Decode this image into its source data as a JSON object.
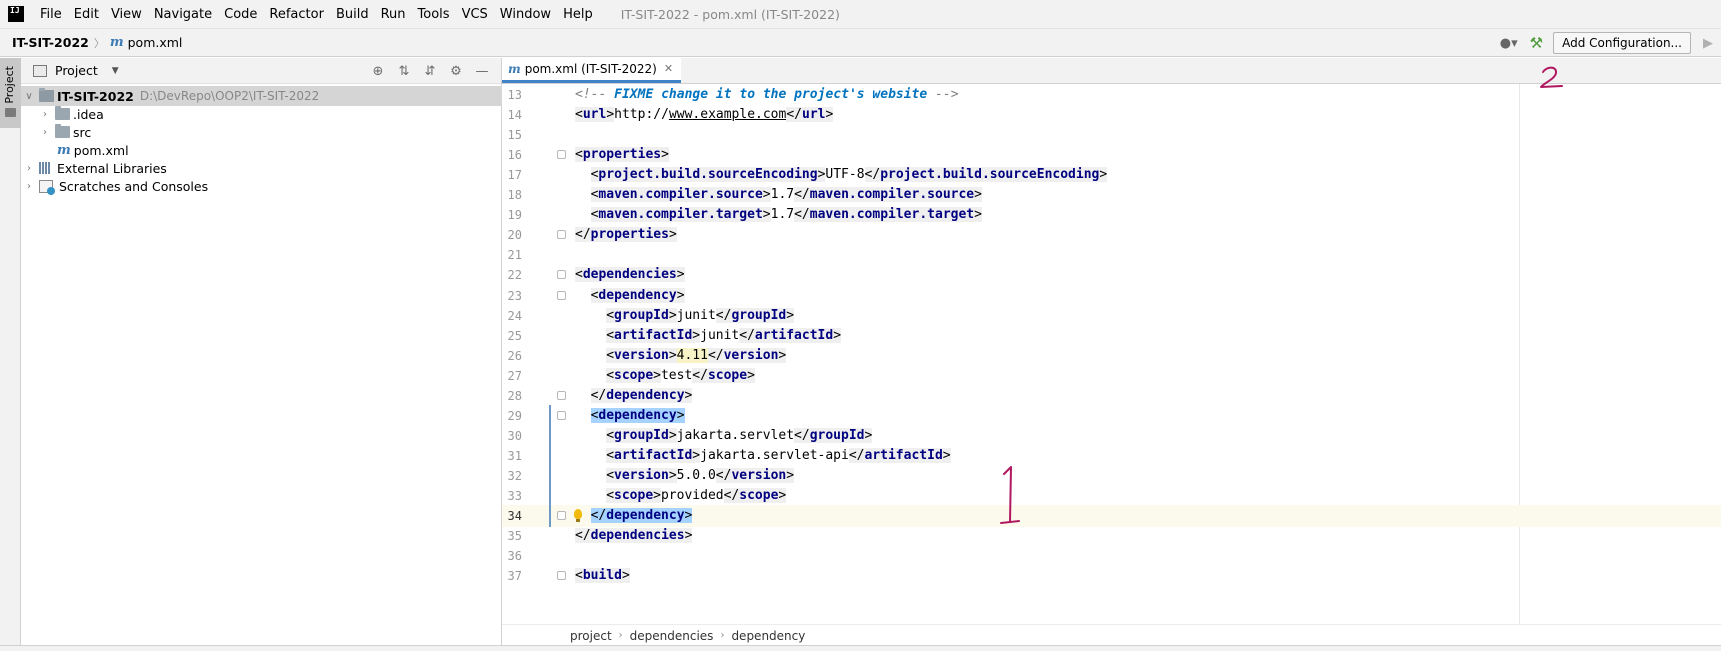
{
  "menu": {
    "logo": "IJ",
    "items": [
      "File",
      "Edit",
      "View",
      "Navigate",
      "Code",
      "Refactor",
      "Build",
      "Run",
      "Tools",
      "VCS",
      "Window",
      "Help"
    ],
    "title": "IT-SIT-2022 - pom.xml (IT-SIT-2022)"
  },
  "navbar": {
    "project": "IT-SIT-2022",
    "file": "pom.xml",
    "add_config_label": "Add Configuration..."
  },
  "toolstrip": {
    "project_label": "Project"
  },
  "project_panel": {
    "title": "Project",
    "tree": [
      {
        "label": "IT-SIT-2022",
        "path": "D:\\DevRepo\\OOP2\\IT-SIT-2022"
      },
      {
        "label": ".idea"
      },
      {
        "label": "src"
      },
      {
        "label": "pom.xml"
      },
      {
        "label": "External Libraries"
      },
      {
        "label": "Scratches and Consoles"
      }
    ]
  },
  "editor": {
    "tab_label": "pom.xml (IT-SIT-2022)",
    "lines": [
      {
        "n": "13",
        "comment_open": "<!-- ",
        "todo": "FIXME change it to the project's website",
        "comment_close": " -->"
      },
      {
        "n": "14",
        "open": "url",
        "text": "http://",
        "ul": "www.example.com",
        "close": "url"
      },
      {
        "n": "15"
      },
      {
        "n": "16",
        "open": "properties"
      },
      {
        "n": "17",
        "open": "project.build.sourceEncoding",
        "text": "UTF-8",
        "close": "project.build.sourceEncoding"
      },
      {
        "n": "18",
        "open": "maven.compiler.source",
        "text": "1.7",
        "close": "maven.compiler.source"
      },
      {
        "n": "19",
        "open": "maven.compiler.target",
        "text": "1.7",
        "close": "maven.compiler.target"
      },
      {
        "n": "20",
        "close": "properties"
      },
      {
        "n": "21"
      },
      {
        "n": "22",
        "open": "dependencies"
      },
      {
        "n": "23",
        "open": "dependency"
      },
      {
        "n": "24",
        "open": "groupId",
        "text": "junit",
        "close": "groupId"
      },
      {
        "n": "25",
        "open": "artifactId",
        "text": "junit",
        "close": "artifactId"
      },
      {
        "n": "26",
        "open": "version",
        "text": "4.11",
        "close": "version"
      },
      {
        "n": "27",
        "open": "scope",
        "text": "test",
        "close": "scope"
      },
      {
        "n": "28",
        "close": "dependency"
      },
      {
        "n": "29",
        "open": "dependency"
      },
      {
        "n": "30",
        "open": "groupId",
        "text": "jakarta.servlet",
        "close": "groupId"
      },
      {
        "n": "31",
        "open": "artifactId",
        "text": "jakarta.servlet-api",
        "close": "artifactId"
      },
      {
        "n": "32",
        "open": "version",
        "text": "5.0.0",
        "close": "version"
      },
      {
        "n": "33",
        "open": "scope",
        "text": "provided",
        "close": "scope"
      },
      {
        "n": "34",
        "close": "dependency"
      },
      {
        "n": "35",
        "close": "dependencies"
      },
      {
        "n": "36"
      },
      {
        "n": "37",
        "open": "build"
      }
    ],
    "breadcrumbs": [
      "project",
      "dependencies",
      "dependency"
    ]
  },
  "annotations": {
    "one": "1",
    "two": "2",
    "color": "#b0175f"
  }
}
